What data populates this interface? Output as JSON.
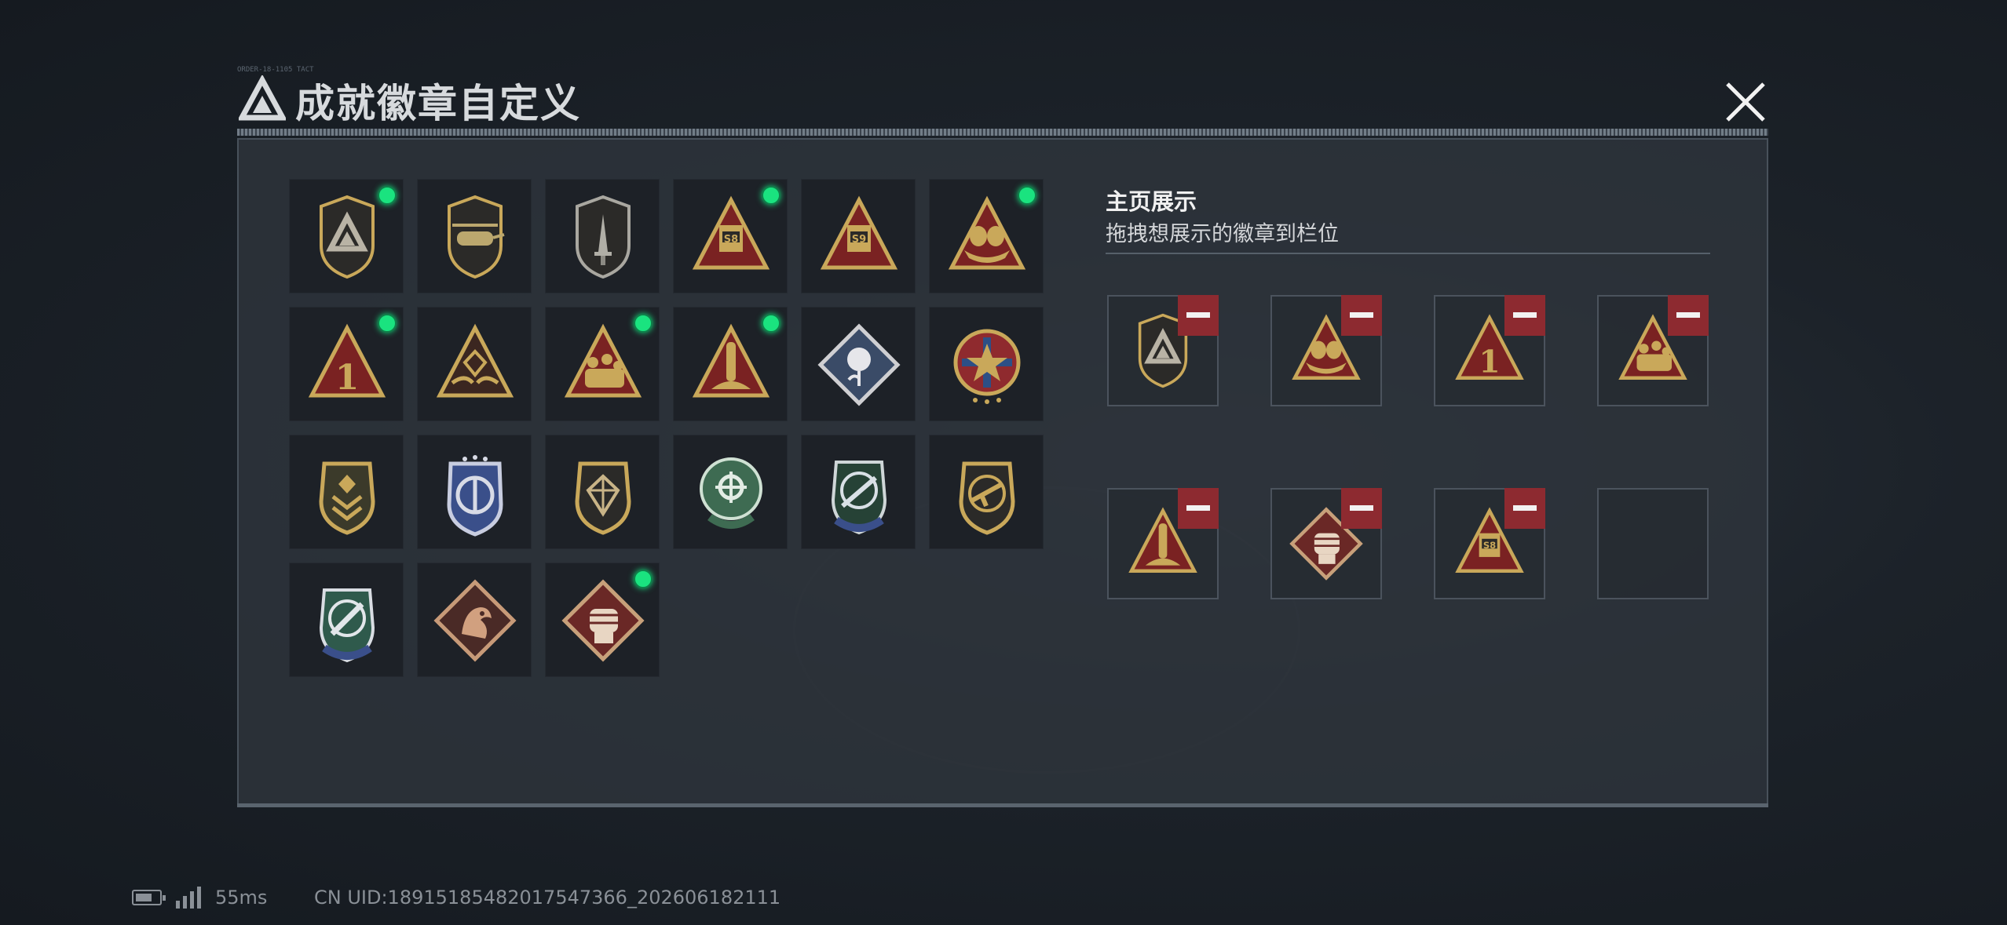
{
  "header": {
    "title": "成就徽章自定义",
    "micro_text": "ORDER-18-1105 TACT"
  },
  "colors": {
    "accent_green": "#1ae37f",
    "remove_red": "#8d2a30",
    "gold": "#c9a85a",
    "panel_bg": "#2e343c"
  },
  "badges": [
    {
      "name": "shield-delta-badge",
      "icon": "shield-delta-icon",
      "is_new": true
    },
    {
      "name": "shield-helicopter-badge",
      "icon": "helicopter-icon",
      "is_new": false
    },
    {
      "name": "shield-dagger-badge",
      "icon": "dagger-icon",
      "is_new": false
    },
    {
      "name": "triangle-s8-badge",
      "icon": "s8-vehicle-icon",
      "is_new": true,
      "text": "S8"
    },
    {
      "name": "triangle-s9-badge",
      "icon": "s9-vehicle-icon",
      "is_new": false,
      "text": "S9"
    },
    {
      "name": "triangle-eggs-badge",
      "icon": "eggs-nest-icon",
      "is_new": true
    },
    {
      "name": "triangle-one-badge",
      "icon": "number-one-icon",
      "is_new": true,
      "text": "1"
    },
    {
      "name": "triangle-hands-badge",
      "icon": "hands-gem-icon",
      "is_new": false
    },
    {
      "name": "triangle-squad-badge",
      "icon": "squad-icon",
      "is_new": true
    },
    {
      "name": "triangle-rocket-badge",
      "icon": "rocket-icon",
      "is_new": true
    },
    {
      "name": "diamond-rose-badge",
      "icon": "rose-icon",
      "is_new": false
    },
    {
      "name": "round-star-badge",
      "icon": "star-medal-icon",
      "is_new": false
    },
    {
      "name": "shield-rank-badge",
      "icon": "chevron-rank-icon",
      "is_new": false
    },
    {
      "name": "blue-shield-badge",
      "icon": "blue-wing-icon",
      "is_new": false
    },
    {
      "name": "shield-gem-badge",
      "icon": "gem-icon",
      "is_new": false
    },
    {
      "name": "green-crosshair-badge",
      "icon": "crosshair-icon",
      "is_new": false
    },
    {
      "name": "blue-rifle-badge",
      "icon": "rifle-crosshair-icon",
      "is_new": false
    },
    {
      "name": "shield-smg-badge",
      "icon": "smg-icon",
      "is_new": false
    },
    {
      "name": "green-knife-badge",
      "icon": "knife-crosshair-icon",
      "is_new": false
    },
    {
      "name": "diamond-dragon-badge",
      "icon": "dragon-icon",
      "is_new": false
    },
    {
      "name": "diamond-fist-badge",
      "icon": "fist-icon",
      "is_new": true
    }
  ],
  "showcase": {
    "title": "主页展示",
    "subtitle": "拖拽想展示的徽章到栏位",
    "slots": [
      {
        "badge": "shield-delta-icon",
        "removable": true
      },
      {
        "badge": "eggs-nest-icon",
        "removable": true
      },
      {
        "badge": "number-one-icon",
        "removable": true,
        "text": "1"
      },
      {
        "badge": "squad-icon",
        "removable": true
      },
      {
        "badge": "rocket-icon",
        "removable": true
      },
      {
        "badge": "fist-icon",
        "removable": true
      },
      {
        "badge": "s8-vehicle-icon",
        "removable": true,
        "text": "S8"
      },
      {
        "badge": "",
        "removable": false
      }
    ]
  },
  "status": {
    "latency": "55ms",
    "uid": "CN UID:18915185482017547366_202606182111"
  }
}
